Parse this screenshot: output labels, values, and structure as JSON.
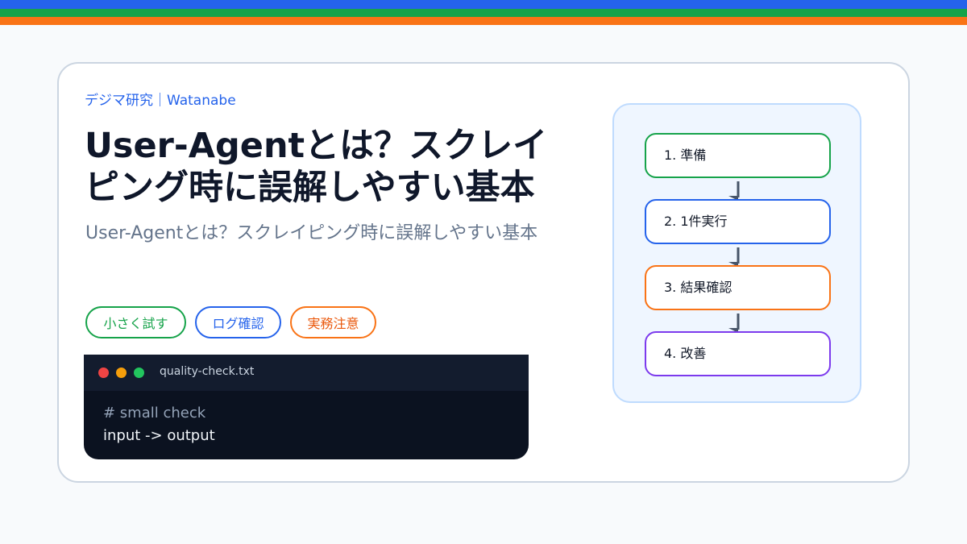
{
  "header": {
    "brand": "デジマ研究｜Watanabe",
    "title": "User-Agentとは？スクレイピング時に誤解しやすい基本",
    "subtitle": "User-Agentとは？スクレイピング時に誤解しやすい基本"
  },
  "tags": [
    "小さく試す",
    "ログ確認",
    "実務注意"
  ],
  "terminal": {
    "filename": "quality-check.txt",
    "lines": [
      "# small check",
      "input -> output"
    ]
  },
  "flow": {
    "steps": [
      "1. 準備",
      "2. 1件実行",
      "3. 結果確認",
      "4. 改善"
    ]
  },
  "colors": {
    "blue": "#2563eb",
    "green": "#16a34a",
    "orange": "#f97316",
    "purple": "#7c3aed"
  }
}
